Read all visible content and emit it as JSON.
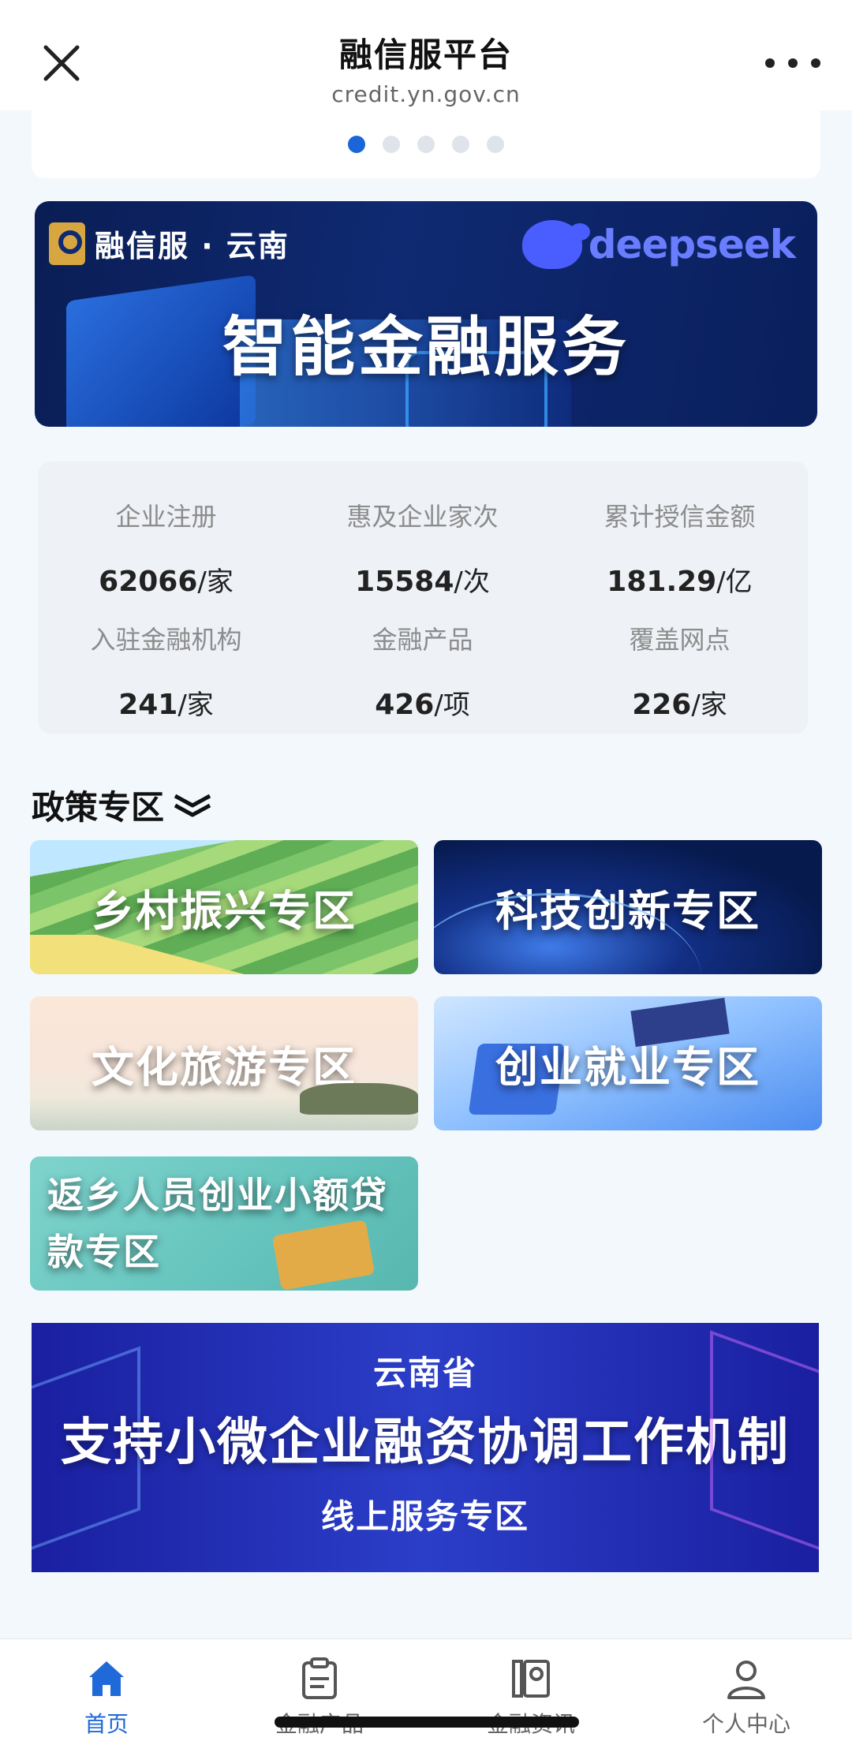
{
  "header": {
    "title": "融信服平台",
    "subtitle": "credit.yn.gov.cn",
    "close_icon": "close-icon",
    "more_icon": "more-icon"
  },
  "carousel": {
    "dot_count": 5,
    "active_index": 0,
    "accent": "#1a66d8"
  },
  "ai_banner": {
    "brand": "融信服 · 云南",
    "partner": "deepseek",
    "headline": "智能金融服务"
  },
  "stats": [
    {
      "label": "企业注册",
      "value": "62066",
      "unit": "/家"
    },
    {
      "label": "惠及企业家次",
      "value": "15584",
      "unit": "/次"
    },
    {
      "label": "累计授信金额",
      "value": "181.29",
      "unit": "/亿"
    },
    {
      "label": "入驻金融机构",
      "value": "241",
      "unit": "/家"
    },
    {
      "label": "金融产品",
      "value": "426",
      "unit": "/项"
    },
    {
      "label": "覆盖网点",
      "value": "226",
      "unit": "/家"
    }
  ],
  "policy": {
    "title": "政策专区",
    "tiles": [
      {
        "label": "乡村振兴专区"
      },
      {
        "label": "科技创新专区"
      },
      {
        "label": "文化旅游专区"
      },
      {
        "label": "创业就业专区"
      },
      {
        "label": "返乡人员创业小额贷款专区"
      }
    ]
  },
  "bottom_banner": {
    "line1": "云南省",
    "line2": "支持小微企业融资协调工作机制",
    "line3": "线上服务专区"
  },
  "tabbar": [
    {
      "label": "首页",
      "icon": "home-icon",
      "active": true
    },
    {
      "label": "金融产品",
      "icon": "clipboard-icon",
      "active": false
    },
    {
      "label": "金融资讯",
      "icon": "news-icon",
      "active": false
    },
    {
      "label": "个人中心",
      "icon": "user-icon",
      "active": false
    }
  ],
  "colors": {
    "accent": "#1f6ad8",
    "page_bg": "#f3f8fd"
  }
}
